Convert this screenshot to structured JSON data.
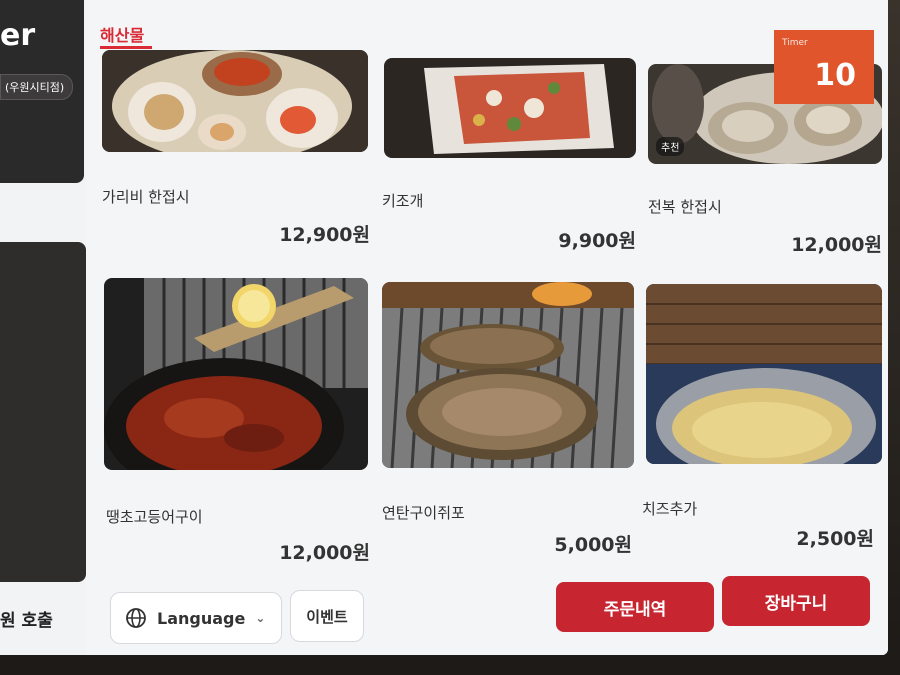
{
  "sidebar": {
    "logo": "er",
    "store": "(우원시티점)",
    "call_label": "원 호출"
  },
  "category": {
    "label": "해산물"
  },
  "timer": {
    "label": "Timer",
    "value": "10"
  },
  "menu_items": [
    {
      "name": "가리비 한접시",
      "price": "12,900원"
    },
    {
      "name": "키조개",
      "price": "9,900원"
    },
    {
      "name": "전복 한접시",
      "price": "12,000원",
      "badge": "추천"
    },
    {
      "name": "땡초고등어구이",
      "price": "12,000원"
    },
    {
      "name": "연탄구이쥐포",
      "price": "5,000원"
    },
    {
      "name": "치즈추가",
      "price": "2,500원"
    }
  ],
  "footer": {
    "language_label": "Language",
    "event_label": "이벤트",
    "order_history_label": "주문내역",
    "cart_label": "장바구니"
  },
  "colors": {
    "accent": "#c7252f",
    "category": "#d82b35",
    "timer_bg": "#e0552b"
  }
}
